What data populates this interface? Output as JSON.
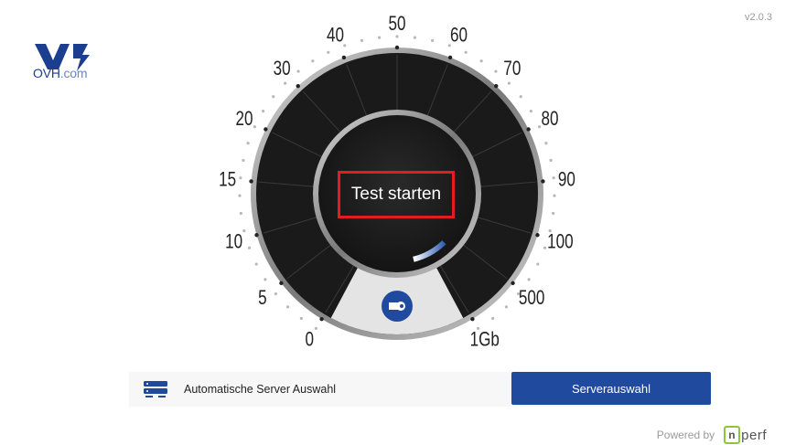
{
  "app": {
    "version": "v2.0.3",
    "logo_text_main": "OVH",
    "logo_text_suffix": ".com"
  },
  "gauge": {
    "scale_labels": [
      "0",
      "5",
      "10",
      "15",
      "20",
      "30",
      "40",
      "50",
      "60",
      "70",
      "80",
      "90",
      "100",
      "500",
      "1Gb"
    ],
    "start_label": "Test starten",
    "settings_icon": "wrench-icon",
    "colors": {
      "dial": "#1a1a1a",
      "accent_blue": "#1f4a9e",
      "highlight": "#e31b23"
    }
  },
  "server": {
    "icon": "server-icon",
    "label": "Automatische Server Auswahl",
    "button_label": "Serverauswahl"
  },
  "footer": {
    "powered_by": "Powered by",
    "brand_box": "n",
    "brand_text": "perf",
    "brand_color": "#8cc63f"
  }
}
